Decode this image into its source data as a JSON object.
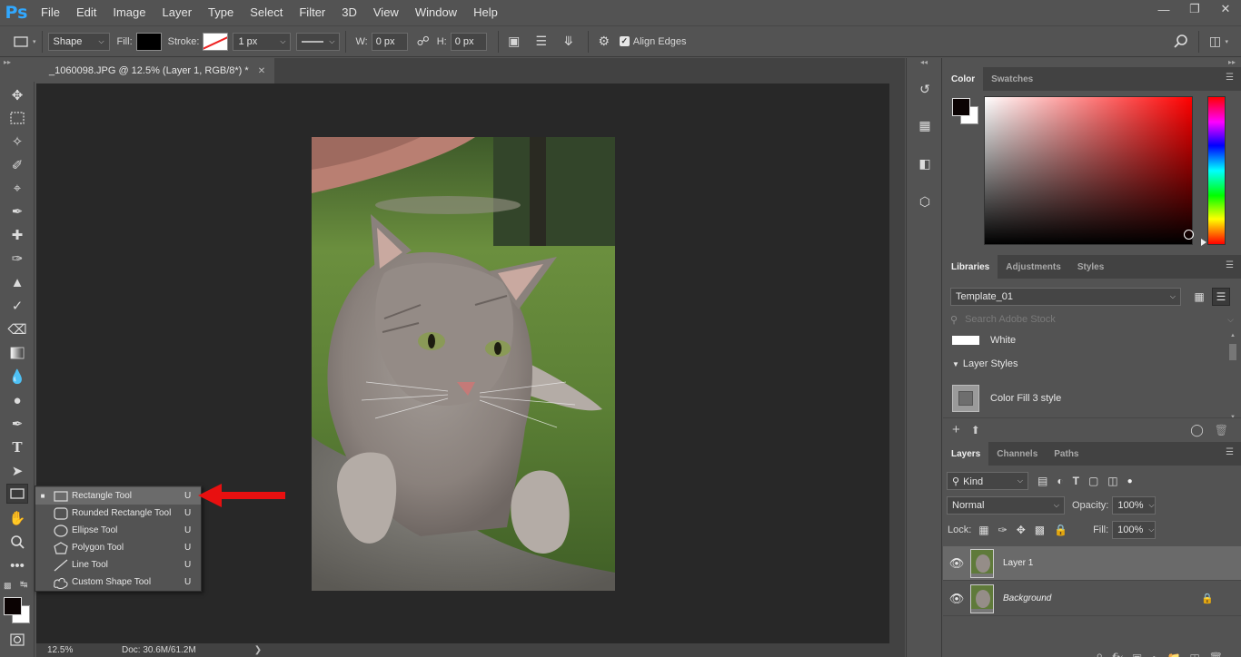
{
  "app": {
    "logo": "Ps",
    "menu": [
      "File",
      "Edit",
      "Image",
      "Layer",
      "Type",
      "Select",
      "Filter",
      "3D",
      "View",
      "Window",
      "Help"
    ],
    "window_controls": [
      "minimize-icon",
      "restore-icon",
      "close-icon"
    ]
  },
  "options_bar": {
    "tool_mode": "Shape",
    "fill_label": "Fill:",
    "stroke_label": "Stroke:",
    "stroke_width": "1 px",
    "w_label": "W:",
    "w_value": "0 px",
    "h_label": "H:",
    "h_value": "0 px",
    "align_edges_label": "Align Edges",
    "align_edges_checked": true
  },
  "document": {
    "tab_title": "_1060098.JPG @ 12.5% (Layer 1, RGB/8*) *",
    "zoom": "12.5%",
    "doc_size": "Doc: 30.6M/61.2M"
  },
  "flyout": {
    "items": [
      {
        "label": "Rectangle Tool",
        "key": "U",
        "icon": "rectangle-icon",
        "selected": true
      },
      {
        "label": "Rounded Rectangle Tool",
        "key": "U",
        "icon": "rounded-rectangle-icon",
        "selected": false
      },
      {
        "label": "Ellipse Tool",
        "key": "U",
        "icon": "ellipse-icon",
        "selected": false
      },
      {
        "label": "Polygon Tool",
        "key": "U",
        "icon": "polygon-icon",
        "selected": false
      },
      {
        "label": "Line Tool",
        "key": "U",
        "icon": "line-icon",
        "selected": false
      },
      {
        "label": "Custom Shape Tool",
        "key": "U",
        "icon": "custom-shape-icon",
        "selected": false
      }
    ]
  },
  "color_panel": {
    "tabs": [
      "Color",
      "Swatches"
    ],
    "foreground": "#0b0303",
    "background": "#ffffff"
  },
  "libraries_panel": {
    "tabs": [
      "Libraries",
      "Adjustments",
      "Styles"
    ],
    "library": "Template_01",
    "search_placeholder": "Search Adobe Stock",
    "items": {
      "white_label": "White",
      "section_label": "Layer Styles",
      "style_label": "Color Fill 3 style"
    }
  },
  "layers_panel": {
    "tabs": [
      "Layers",
      "Channels",
      "Paths"
    ],
    "kind": "Kind",
    "blend_mode": "Normal",
    "opacity_label": "Opacity:",
    "opacity": "100%",
    "lock_label": "Lock:",
    "fill_label": "Fill:",
    "fill": "100%",
    "layers": [
      {
        "name": "Layer 1",
        "selected": true,
        "locked": false
      },
      {
        "name": "Background",
        "selected": false,
        "locked": true
      }
    ]
  },
  "colors": {
    "accent": "#31a8ff",
    "arrow": "#e81010"
  }
}
